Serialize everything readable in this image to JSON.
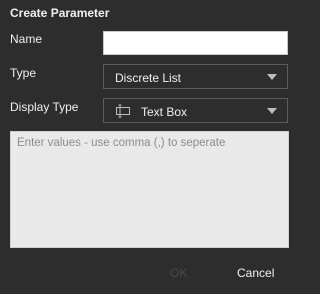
{
  "dialog": {
    "title": "Create Parameter"
  },
  "form": {
    "name_label": "Name",
    "name_value": "",
    "type_label": "Type",
    "type_value": "Discrete List",
    "display_type_label": "Display Type",
    "display_type_value": "Text Box",
    "display_type_icon": "textbox-icon",
    "values_placeholder": "Enter values - use comma (,) to seperate",
    "values_value": ""
  },
  "footer": {
    "ok_label": "OK",
    "ok_enabled": false,
    "cancel_label": "Cancel"
  },
  "colors": {
    "dialog_background": "#2d2d2d",
    "input_background": "#ffffff",
    "textarea_background": "#e9e9e9",
    "disabled_text": "#4a4a4a"
  }
}
